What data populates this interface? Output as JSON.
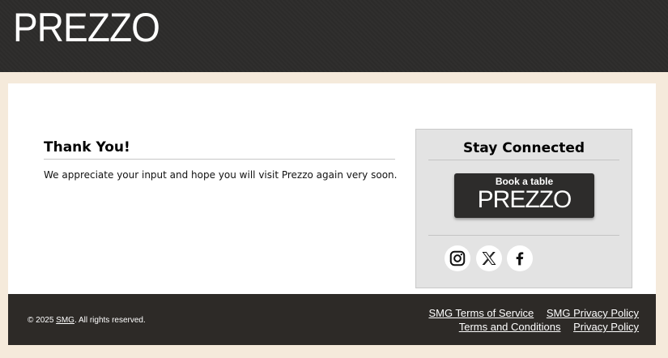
{
  "header": {
    "logo_text": "PREZZO"
  },
  "main": {
    "title": "Thank You!",
    "message": "We appreciate your input and hope you will visit Prezzo again very soon."
  },
  "panel": {
    "title": "Stay Connected",
    "book_label": "Book a table",
    "book_logo": "PREZZO",
    "social": [
      "instagram-icon",
      "x-icon",
      "facebook-icon"
    ]
  },
  "footer": {
    "copyright_prefix": "© 2025 ",
    "copyright_link": "SMG",
    "copyright_suffix": ". All rights reserved.",
    "links_row1": [
      "SMG Terms of Service",
      "SMG Privacy Policy"
    ],
    "links_row2": [
      "Terms and Conditions",
      "Privacy Policy"
    ]
  },
  "colors": {
    "header_bg": "#2d2c2b",
    "page_bg": "#f5eadb",
    "panel_bg": "#e3e3e3",
    "footer_bg": "#2d2a27"
  }
}
